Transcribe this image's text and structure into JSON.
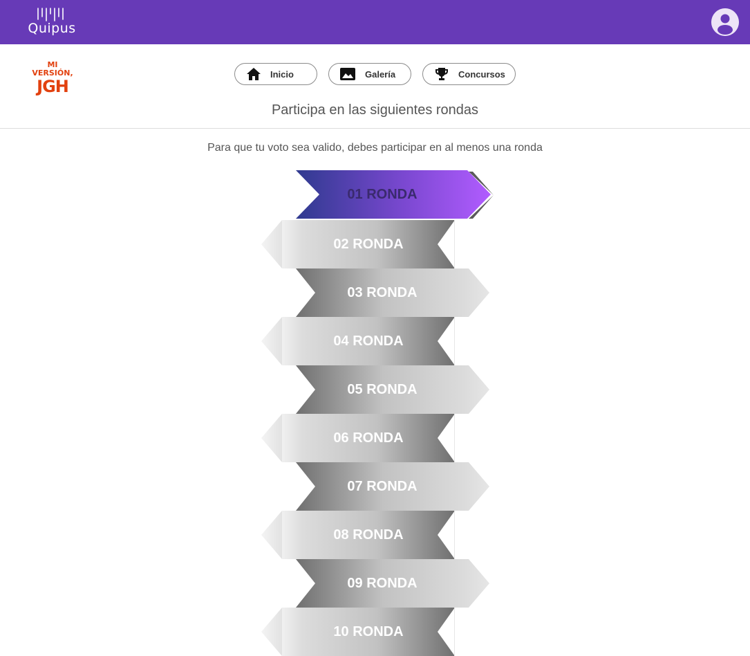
{
  "topbar": {
    "logo_text": "Quipus",
    "bg_color": "#673ab7",
    "avatar_icon": "account-circle-icon"
  },
  "header": {
    "brand_logo": {
      "line1": "MI",
      "line2": "VERSIÓN,",
      "line3": "JGH",
      "color": "#e2410f"
    }
  },
  "nav": {
    "items": [
      {
        "label": "Inicio",
        "icon": "home-icon"
      },
      {
        "label": "Galería",
        "icon": "image-icon"
      },
      {
        "label": "Concursos",
        "icon": "trophy-icon"
      }
    ]
  },
  "main": {
    "title": "Participa en las siguientes rondas",
    "subtitle": "Para que tu voto sea valido, debes participar en al menos una ronda",
    "rounds": [
      {
        "label": "01 RONDA",
        "active": true
      },
      {
        "label": "02 RONDA",
        "active": false
      },
      {
        "label": "03 RONDA",
        "active": false
      },
      {
        "label": "04 RONDA",
        "active": false
      },
      {
        "label": "05 RONDA",
        "active": false
      },
      {
        "label": "06 RONDA",
        "active": false
      },
      {
        "label": "07 RONDA",
        "active": false
      },
      {
        "label": "08 RONDA",
        "active": false
      },
      {
        "label": "09 RONDA",
        "active": false
      },
      {
        "label": "10 RONDA",
        "active": false
      }
    ],
    "colors": {
      "active_gradient_start": "#2f3a8f",
      "active_gradient_end": "#b15cff",
      "inactive_dark": "#7d7d7d",
      "inactive_light": "#dedede"
    }
  }
}
